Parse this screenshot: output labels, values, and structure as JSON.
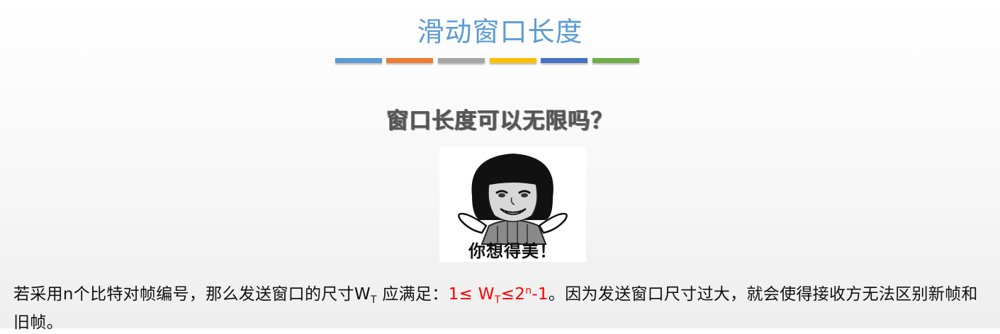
{
  "slide": {
    "title": "滑动窗口长度",
    "title_color": "#5b9bd5",
    "divider_colors": [
      "#5b9bd5",
      "#ed7d31",
      "#a5a5a5",
      "#ffc000",
      "#4472c4",
      "#70ad47"
    ],
    "question": "窗口长度可以无限吗？",
    "meme_caption": "你想得美！",
    "body": {
      "part1": "若采用n个比特对帧编号，那么发送窗口的尺寸W",
      "part1_sub": "T",
      "part2": " 应满足：",
      "formula_a": "1≤ W",
      "formula_sub": "T",
      "formula_b": "≤2",
      "formula_sup": "n",
      "formula_c": "-1",
      "part3": "。因为发送窗口尺寸过大，就会使得接收方无法区别新帧和旧帧。",
      "highlight_color": "#ff0000"
    }
  }
}
